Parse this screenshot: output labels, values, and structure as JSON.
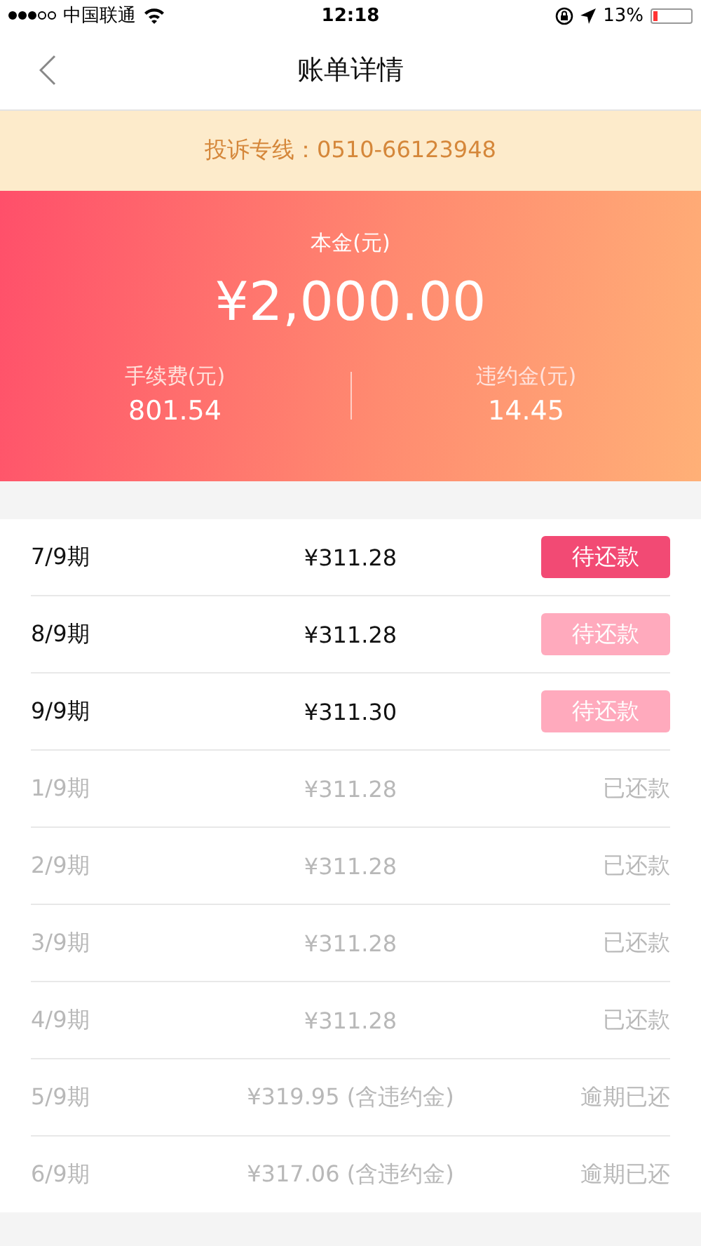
{
  "status_bar": {
    "carrier": "中国联通",
    "time": "12:18",
    "battery_percent": "13%",
    "level": 0.13
  },
  "nav": {
    "title": "账单详情"
  },
  "notice": "投诉专线：0510-66123948",
  "summary": {
    "principal_label": "本金(元)",
    "principal": "¥2,000.00",
    "fee_label": "手续费(元)",
    "fee": "801.54",
    "penalty_label": "违约金(元)",
    "penalty": "14.45"
  },
  "installments": [
    {
      "period": "7/9期",
      "amount": "¥311.28",
      "kind": "pending",
      "status": "待还款",
      "disabled": false
    },
    {
      "period": "8/9期",
      "amount": "¥311.28",
      "kind": "pending",
      "status": "待还款",
      "disabled": true
    },
    {
      "period": "9/9期",
      "amount": "¥311.30",
      "kind": "pending",
      "status": "待还款",
      "disabled": true
    },
    {
      "period": "1/9期",
      "amount": "¥311.28",
      "kind": "paid",
      "status": "已还款"
    },
    {
      "period": "2/9期",
      "amount": "¥311.28",
      "kind": "paid",
      "status": "已还款"
    },
    {
      "period": "3/9期",
      "amount": "¥311.28",
      "kind": "paid",
      "status": "已还款"
    },
    {
      "period": "4/9期",
      "amount": "¥311.28",
      "kind": "paid",
      "status": "已还款"
    },
    {
      "period": "5/9期",
      "amount": "¥319.95 (含违约金)",
      "kind": "paid",
      "status": "逾期已还"
    },
    {
      "period": "6/9期",
      "amount": "¥317.06 (含违约金)",
      "kind": "paid",
      "status": "逾期已还"
    }
  ]
}
